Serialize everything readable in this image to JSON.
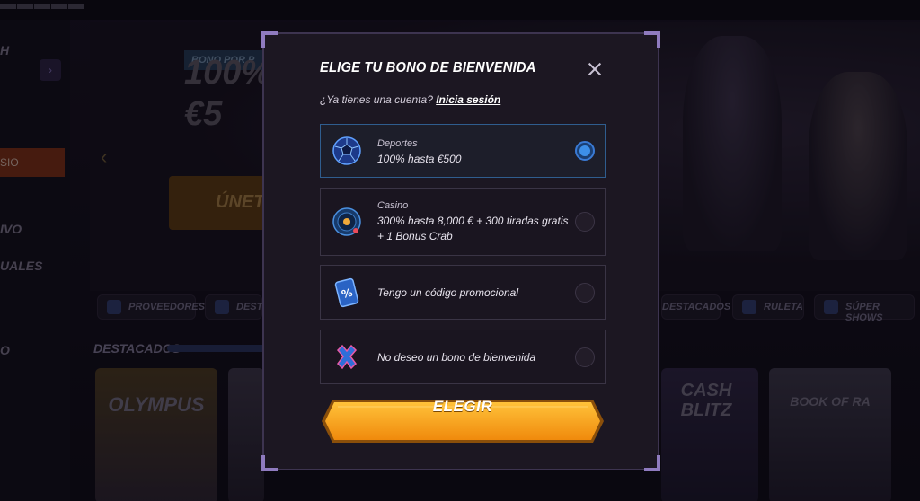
{
  "modal": {
    "title": "ELIGE TU BONO DE BIENVENIDA",
    "account_prompt": "¿Ya tienes una cuenta?",
    "login_link": "Inicia sesión",
    "options": [
      {
        "title": "Deportes",
        "detail": "100% hasta €500",
        "selected": true,
        "icon": "soccer-ball-icon"
      },
      {
        "title": "Casino",
        "detail": "300% hasta 8,000 € + 300 tiradas gratis",
        "detail2": "+ 1 Bonus Crab",
        "selected": false,
        "icon": "roulette-wheel-icon"
      },
      {
        "title": "Tengo un código promocional",
        "selected": false,
        "icon": "promo-ticket-icon"
      },
      {
        "title": "No deseo un bono de bienvenida",
        "selected": false,
        "icon": "x-mark-icon"
      }
    ],
    "cta_label": "ELEGIR"
  },
  "background": {
    "hero_banner": "BONO POR P",
    "hero_promo_line1": "100%",
    "hero_promo_line2": "€5",
    "hero_button": "ÚNETE",
    "sidebar_items": [
      "H",
      "SIO",
      "IVO",
      "UALES",
      "O"
    ],
    "category_pills": [
      "PROVEEDORES",
      "DEST",
      "DESTACADOS",
      "RULETA",
      "SÚPER SHOWS"
    ],
    "featured_heading": "DESTACADOS",
    "game_tiles": [
      "OLYMPUS",
      "CASH BLITZ",
      "BOOK OF RA"
    ],
    "colors": {
      "accent": "#f5a623",
      "selected_border": "#2f5d8e",
      "radio_on": "#3d8fe8"
    }
  }
}
